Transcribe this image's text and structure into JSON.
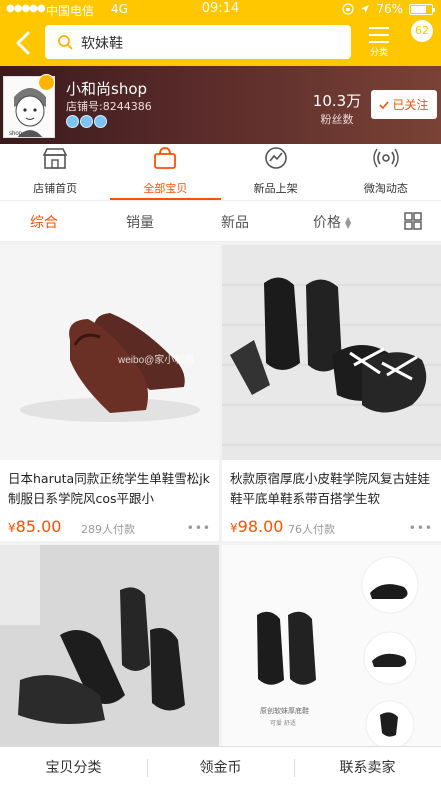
{
  "status_bar": {
    "signal": "●●●●●",
    "carrier": "中国电信",
    "network": "4G",
    "time": "09:14",
    "battery": "76%",
    "battery_level": 0.76
  },
  "nav": {
    "search_text": "软妹鞋",
    "menu_label": "分类",
    "message_count": "62"
  },
  "shop": {
    "name": "小和尚shop",
    "store_id": "店铺号:8244386",
    "avatar_text": "shop",
    "fans_count": "10.3万",
    "fans_label": "粉丝数",
    "follow_label": "已关注"
  },
  "shop_tabs": [
    {
      "label": "店铺首页",
      "icon": "store-icon"
    },
    {
      "label": "全部宝贝",
      "icon": "bag-icon"
    },
    {
      "label": "新品上架",
      "icon": "new-arrival-icon"
    },
    {
      "label": "微淘动态",
      "icon": "broadcast-icon"
    }
  ],
  "sort_bar": {
    "items": [
      "综合",
      "销量",
      "新品",
      "价格"
    ],
    "active": "综合"
  },
  "products": [
    {
      "title": "日本haruta同款正统学生单鞋雪松jk制服日系学院风cos平跟小",
      "currency": "¥",
      "price": "85.00",
      "sold": "289人付款",
      "watermark": "weibo@家小和尚"
    },
    {
      "title": "秋款原宿厚底小皮鞋学院风复古娃娃鞋平底单鞋系带百搭学生软",
      "currency": "¥",
      "price": "98.00",
      "sold": "76人付款"
    },
    {
      "title": "",
      "currency": "",
      "price": "",
      "sold": ""
    },
    {
      "title": "",
      "currency": "",
      "price": "",
      "sold": "",
      "photo_caption": "原创软妹厚底鞋",
      "photo_caption_2": "可爱 舒适"
    }
  ],
  "bottom_bar": [
    "宝贝分类",
    "领金币",
    "联系卖家"
  ],
  "colors": {
    "brand_yellow": "#ffc700",
    "accent_orange": "#ff5000"
  }
}
